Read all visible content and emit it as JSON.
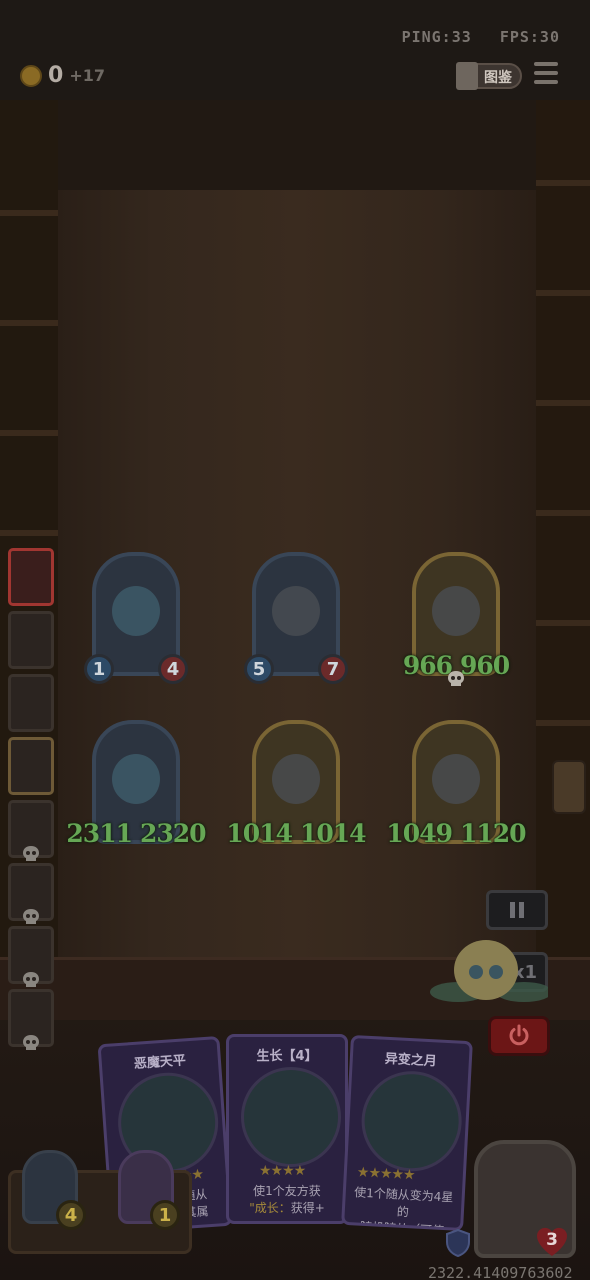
{
  "header": {
    "ping": "PING:33",
    "fps": "FPS:30",
    "gold": "0",
    "gold_gain": "+17",
    "codex_label": "图鉴"
  },
  "board": {
    "row1": [
      {
        "atk": "1",
        "hp": "4",
        "frame": "blue"
      },
      {
        "atk": "5",
        "hp": "7",
        "frame": "blue"
      },
      {
        "atk": "966",
        "hp": "960",
        "frame": "gold"
      }
    ],
    "row2": [
      {
        "atk": "2311",
        "hp": "2320",
        "frame": "blue"
      },
      {
        "atk": "1014",
        "hp": "1014",
        "frame": "gold"
      },
      {
        "atk": "1049",
        "hp": "1120",
        "frame": "gold"
      }
    ]
  },
  "controls": {
    "speed_label": "x1"
  },
  "hand": [
    {
      "name": "恶魔天平",
      "stars": "★★",
      "text_line1": "方随从",
      "text_line2": "得其属"
    },
    {
      "name": "生长【4】",
      "stars": "★★★★",
      "text_line1": "使1个友方获",
      "text_keyword": "\"成长：",
      "text_line2_rest": "获得+"
    },
    {
      "name": "异变之月",
      "stars": "★★★★★",
      "text_line1": "使1个随从变为4星的",
      "text_line2": "随机随从（可使"
    }
  ],
  "tray": [
    {
      "value": "4"
    },
    {
      "value": "1"
    }
  ],
  "hero": {
    "hp": "3"
  },
  "footer": {
    "seed": "2322.41409763602"
  },
  "colors": {
    "stat_green": "#66a755",
    "active_slot": "#a13631",
    "power_red": "#6c1616"
  }
}
